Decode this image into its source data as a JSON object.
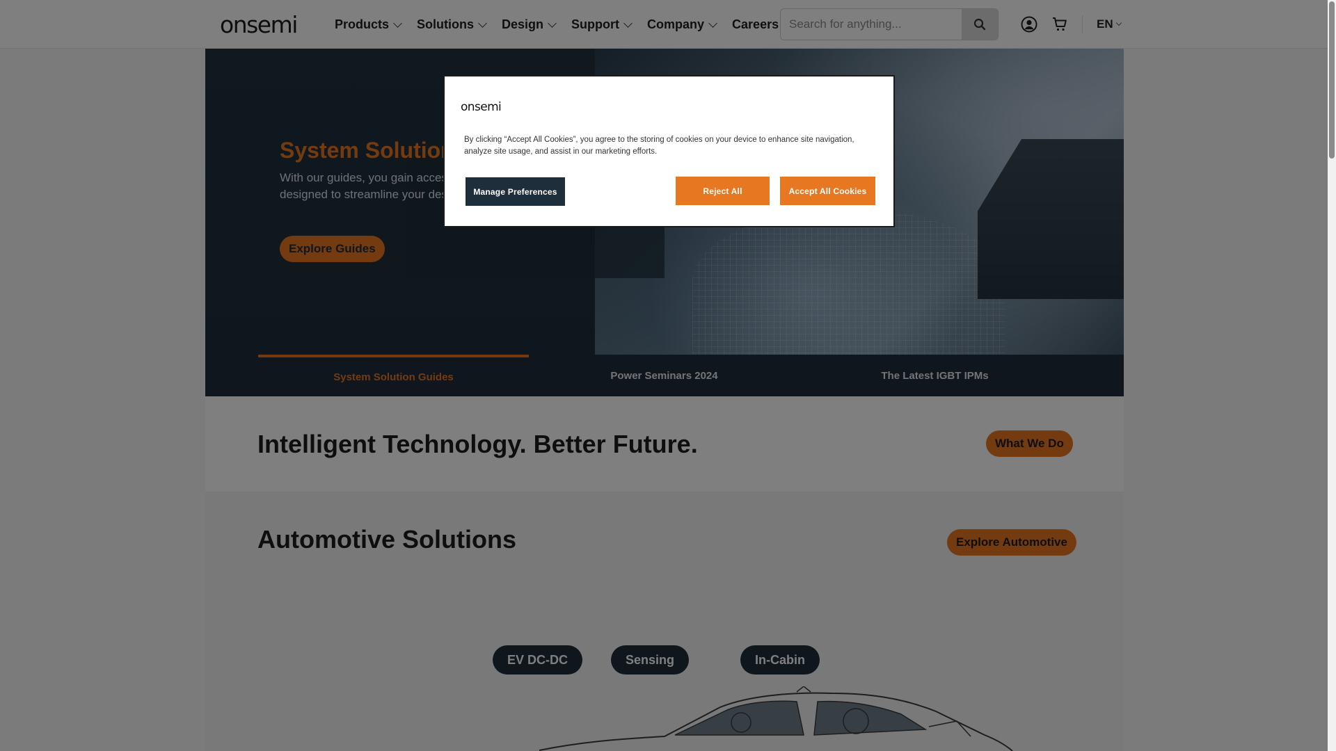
{
  "header": {
    "logo": "onsemi",
    "nav": [
      {
        "label": "Products"
      },
      {
        "label": "Solutions"
      },
      {
        "label": "Design"
      },
      {
        "label": "Support"
      },
      {
        "label": "Company"
      },
      {
        "label": "Careers"
      }
    ],
    "search_placeholder": "Search for anything...",
    "language": "EN"
  },
  "hero": {
    "title": "System Solution Guides",
    "description": "With our guides, you gain access to information and resources designed to streamline your design process.",
    "button": "Explore Guides",
    "tabs": [
      {
        "label": "System Solution Guides",
        "active": true
      },
      {
        "label": "Power Seminars 2024",
        "active": false
      },
      {
        "label": "The Latest IGBT IPMs",
        "active": false
      }
    ]
  },
  "tagline": {
    "text": "Intelligent Technology. Better Future.",
    "button": "What We Do"
  },
  "automotive": {
    "title": "Automotive Solutions",
    "button": "Explore Automotive",
    "chips": [
      "EV DC-DC",
      "Sensing",
      "In-Cabin"
    ]
  },
  "cookie_modal": {
    "logo": "onsemi",
    "text": "By clicking “Accept All Cookies”, you agree to the storing of cookies on your device to enhance site navigation, analyze site usage, and assist in our marketing efforts.",
    "manage_label": "Manage Preferences",
    "reject_label": "Reject All",
    "accept_label": "Accept All Cookies"
  },
  "colors": {
    "accent": "#e87722",
    "navy": "#1f2e3b",
    "overlay": "rgba(0,0,0,0.5)"
  },
  "icons": [
    "search-icon",
    "user-icon",
    "cart-icon",
    "chevron-down-icon"
  ]
}
